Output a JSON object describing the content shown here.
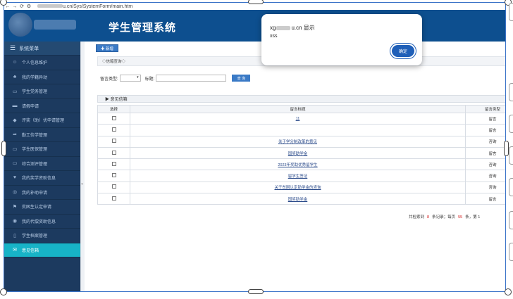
{
  "browser": {
    "url_suffix": "u.cn/Sys/SystemForm/main.htm",
    "back_glyph": "←",
    "forward_glyph": "→",
    "reload_glyph": "⟳",
    "settings_glyph": "⚙"
  },
  "header": {
    "system_title": "学生管理系统"
  },
  "sidebar": {
    "menu_title": "系统菜单",
    "items": [
      {
        "label": "个人信息维护",
        "icon": "user-icon",
        "glyph": "☺"
      },
      {
        "label": "我的学籍异动",
        "icon": "org-icon",
        "glyph": "♣"
      },
      {
        "label": "学生党务管理",
        "icon": "folder-icon",
        "glyph": "▭"
      },
      {
        "label": "请假申请",
        "icon": "folder-open-icon",
        "glyph": "▬"
      },
      {
        "label": "评奖（助）优申请管理",
        "icon": "graduation-cap-icon",
        "glyph": "◆"
      },
      {
        "label": "勤工俭学管理",
        "icon": "share-icon",
        "glyph": "➦"
      },
      {
        "label": "学生医保管理",
        "icon": "file-icon",
        "glyph": "▭"
      },
      {
        "label": "综合测评管理",
        "icon": "folder-icon",
        "glyph": "▭"
      },
      {
        "label": "我的奖学资助信息",
        "icon": "heart-icon",
        "glyph": "♥"
      },
      {
        "label": "我的补助申请",
        "icon": "handshake-icon",
        "glyph": "◎"
      },
      {
        "label": "贫困生认定申请",
        "icon": "flag-icon",
        "glyph": "⚑"
      },
      {
        "label": "我的代偿资助信息",
        "icon": "user-circle-icon",
        "glyph": "◉"
      },
      {
        "label": "学生档案管理",
        "icon": "building-icon",
        "glyph": "▯"
      },
      {
        "label": "意见信箱",
        "icon": "envelope-icon",
        "glyph": "✉"
      }
    ]
  },
  "content": {
    "add_button": "✚ 新增",
    "breadcrumb": "◇信箱查询◇",
    "search": {
      "type_label": "留言类型:",
      "type_value": "▾",
      "title_label": "标题:",
      "title_value": "",
      "query_button": "查 询"
    },
    "panel_title": "▶  意见信箱",
    "table": {
      "headers": [
        "选择",
        "留言标题",
        "留言类型"
      ],
      "rows": [
        {
          "title": "11",
          "type": "留言"
        },
        {
          "title": "",
          "type": "留言"
        },
        {
          "title": "关于学分制改革的意见",
          "type": "咨询"
        },
        {
          "title": "国奖助学金",
          "type": "留言"
        },
        {
          "title": "2023年奖助优秀留学生",
          "type": "咨询"
        },
        {
          "title": "留学生签证",
          "type": "咨询"
        },
        {
          "title": "关于贫困认定助学金的咨询",
          "type": "咨询"
        },
        {
          "title": "国奖助学金",
          "type": "留言"
        }
      ]
    },
    "pager": {
      "prefix": "共检索到",
      "count": "8",
      "records_label": "条记录；每页",
      "per_page": "55",
      "suffix": "条，第 1"
    }
  },
  "dialog": {
    "title_prefix": "xg",
    "title_mid": "u.cn 显示",
    "message": "xss",
    "ok_button": "确定"
  }
}
